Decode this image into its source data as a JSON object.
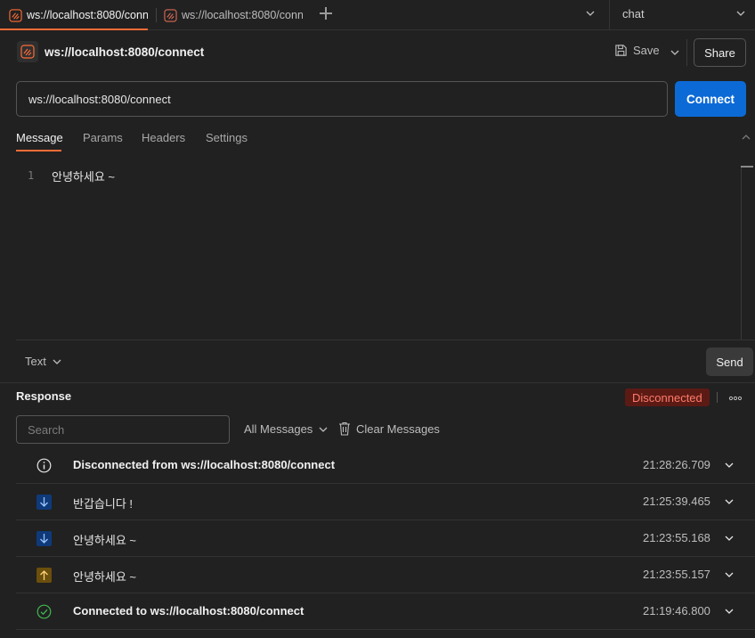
{
  "tabs": [
    {
      "label": "ws://localhost:8080/connect",
      "unsaved": true,
      "active": true
    },
    {
      "label": "ws://localhost:8080/connect",
      "unsaved": true,
      "active": false
    }
  ],
  "environment": {
    "selected": "chat"
  },
  "header": {
    "title": "ws://localhost:8080/connect",
    "save_label": "Save",
    "share_label": "Share"
  },
  "url_bar": {
    "value": "ws://localhost:8080/connect",
    "connect_label": "Connect"
  },
  "request_tabs": [
    "Message",
    "Params",
    "Headers",
    "Settings"
  ],
  "editor": {
    "line_number": "1",
    "line_text": "안녕하세요 ~"
  },
  "footer": {
    "format": "Text",
    "send_label": "Send"
  },
  "response": {
    "title": "Response",
    "status": "Disconnected",
    "search_placeholder": "Search",
    "filter_label": "All Messages",
    "clear_label": "Clear Messages",
    "messages": [
      {
        "icon": "info-icon",
        "text": "Disconnected from ws://localhost:8080/connect",
        "time": "21:28:26.709"
      },
      {
        "icon": "arrow-down-icon",
        "text": "반갑습니다 !",
        "time": "21:25:39.465"
      },
      {
        "icon": "arrow-down-icon",
        "text": "안녕하세요 ~",
        "time": "21:23:55.168"
      },
      {
        "icon": "arrow-up-icon",
        "text": "안녕하세요 ~",
        "time": "21:23:55.157"
      },
      {
        "icon": "check-circle-icon",
        "text": "Connected to ws://localhost:8080/connect",
        "time": "21:19:46.800"
      }
    ]
  },
  "colors": {
    "accent": "#ff6c37",
    "primary_button": "#0c6ad6",
    "disconnected_bg": "#5c1a14",
    "disconnected_text": "#ff7b6b",
    "incoming_badge": "#0f3a7a",
    "outgoing_badge": "#6b4f0c",
    "connected_icon": "#3fb950"
  }
}
